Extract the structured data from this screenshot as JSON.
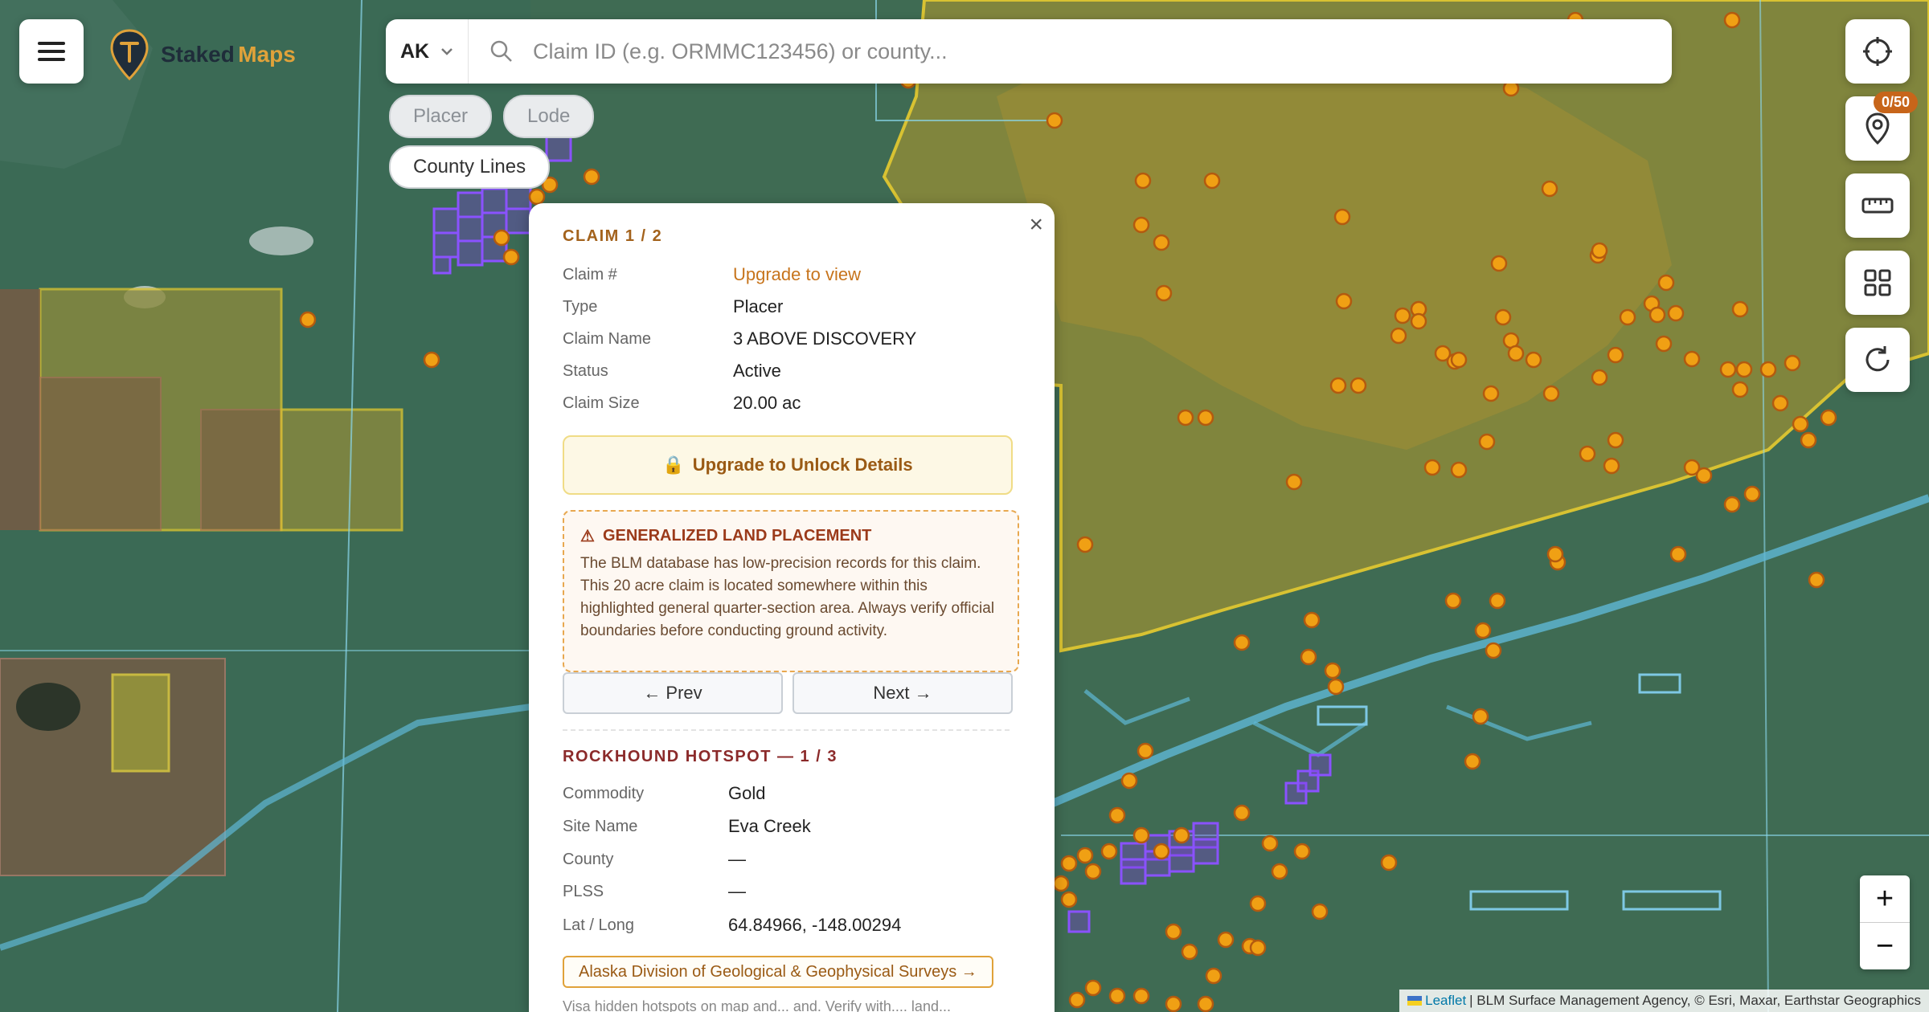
{
  "brand": {
    "word1": "Staked",
    "word2": "Maps"
  },
  "search": {
    "state": "AK",
    "placeholder": "Claim ID (e.g. ORMMC123456) or county..."
  },
  "filters": [
    {
      "label": "Placer",
      "active": false
    },
    {
      "label": "Lode",
      "active": false
    },
    {
      "label": "County Lines",
      "active": true
    }
  ],
  "pins_badge": "0/50",
  "right_tools": [
    "locate-icon",
    "pin-icon",
    "ruler-icon",
    "grid-icon",
    "refresh-icon"
  ],
  "zoom": {
    "in": "+",
    "out": "−"
  },
  "attribution": {
    "leaflet": "Leaflet",
    "rest": "| BLM Surface Management Agency, © Esri, Maxar, Earthstar Geographics"
  },
  "claim": {
    "header": "CLAIM 1 / 2",
    "rows": [
      {
        "label": "Claim #",
        "value": "Upgrade to view"
      },
      {
        "label": "Type",
        "value": "Placer"
      },
      {
        "label": "Claim Name",
        "value": "3 ABOVE DISCOVERY"
      },
      {
        "label": "Status",
        "value": "Active"
      },
      {
        "label": "Claim Size",
        "value": "20.00 ac"
      }
    ],
    "upgrade_label": "Upgrade to Unlock Details",
    "warning_title": "GENERALIZED LAND PLACEMENT",
    "warning_body": "The BLM database has low-precision records for this claim. This 20 acre claim is located somewhere within this highlighted general quarter-section area. Always verify official boundaries before conducting ground activity.",
    "prev_label": "← Prev",
    "next_label": "Next →"
  },
  "hotspot": {
    "header": "ROCKHOUND HOTSPOT — 1 / 3",
    "rows": [
      {
        "label": "Commodity",
        "value": "Gold"
      },
      {
        "label": "Site Name",
        "value": "Eva Creek"
      },
      {
        "label": "County",
        "value": "—"
      },
      {
        "label": "PLSS",
        "value": "—"
      },
      {
        "label": "Lat / Long",
        "value": "64.84966, -148.00294"
      }
    ],
    "source_link": "Alaska Division of Geological & Geophysical Surveys →",
    "note": "Visa hidden hotspots on map and... and. Verify with.... land..."
  },
  "colors": {
    "accent": "#c7741c",
    "brand_gold": "#e0a23a",
    "claim_boundary": "#7b3fd9",
    "hotspot": "#f0a014",
    "county_line": "#8ad7ec",
    "blm_yellow": "#d6b93a"
  }
}
